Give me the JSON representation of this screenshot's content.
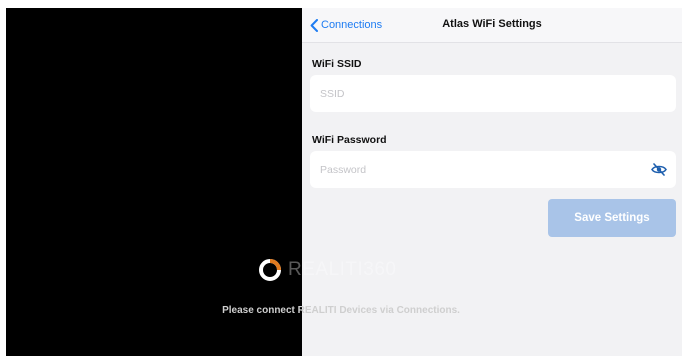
{
  "navigation": {
    "back_label": "Connections",
    "title": "Atlas WiFi Settings"
  },
  "ssid_field": {
    "label": "WiFi SSID",
    "placeholder": "SSID",
    "value": ""
  },
  "password_field": {
    "label": "WiFi Password",
    "placeholder": "Password",
    "value": "",
    "visibility_icon": "eye-slash-icon"
  },
  "save_button": {
    "label": "Save Settings"
  },
  "overlay": {
    "brand_name": "REALITI360",
    "message": "Please connect REALITI Devices via Connections."
  },
  "colors": {
    "accent": "#1e7cf2",
    "save_button_bg": "#a9c4e8",
    "panel_bg": "#f2f2f4",
    "left_bg": "#000000",
    "brand_orange": "#e07a1f"
  }
}
